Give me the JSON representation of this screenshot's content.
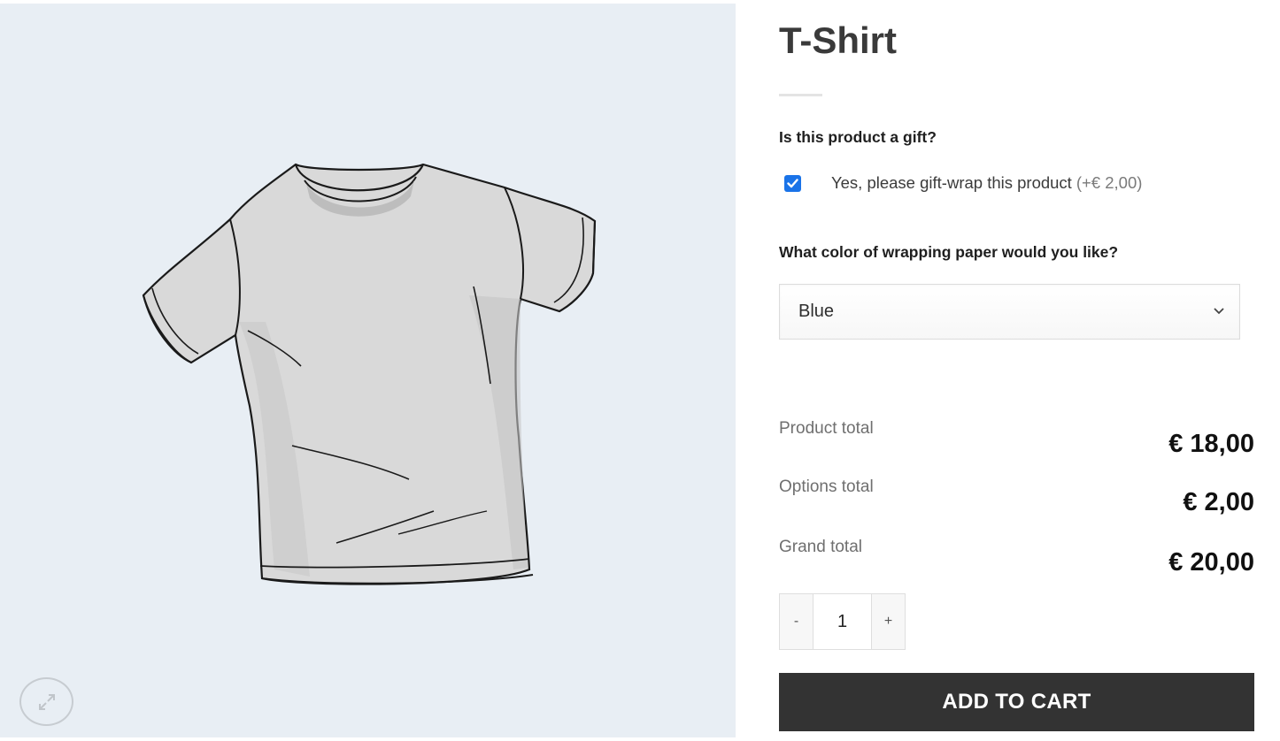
{
  "product": {
    "title": "T-Shirt",
    "image_icon": "tshirt-illustration"
  },
  "gallery": {
    "zoom_icon": "expand-arrows-icon"
  },
  "options": {
    "gift_question": "Is this product a gift?",
    "gift_checkbox_label": "Yes, please gift-wrap this product",
    "gift_checkbox_price": "(+€ 2,00)",
    "gift_checked": true,
    "color_question": "What color of wrapping paper would you like?",
    "color_selected": "Blue"
  },
  "totals": {
    "product_total_label": "Product total",
    "product_total_value": "€ 18,00",
    "options_total_label": "Options total",
    "options_total_value": "€ 2,00",
    "grand_total_label": "Grand total",
    "grand_total_value": "€ 20,00"
  },
  "quantity": {
    "minus_label": "-",
    "value": "1",
    "plus_label": "+"
  },
  "cart": {
    "add_label": "ADD TO CART"
  },
  "colors": {
    "gallery_bg": "#e8eef4",
    "checkbox_accent": "#1a73e8",
    "button_bg": "#333333"
  }
}
